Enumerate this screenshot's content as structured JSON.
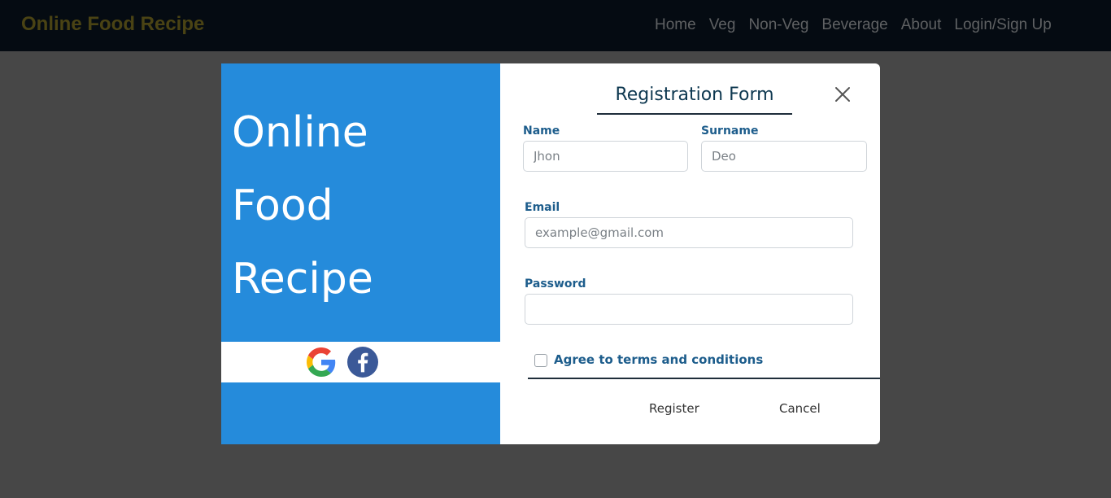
{
  "navbar": {
    "brand": "Online Food Recipe",
    "links": [
      "Home",
      "Veg",
      "Non-Veg",
      "Beverage",
      "About",
      "Login/Sign Up"
    ]
  },
  "modal": {
    "hero_lines": [
      "Online",
      "Food",
      "Recipe"
    ],
    "social_icons": [
      "google-icon",
      "facebook-icon"
    ],
    "title": "Registration Form",
    "close_icon": "close-icon",
    "fields": {
      "name": {
        "label": "Name",
        "value": "",
        "placeholder": "Jhon"
      },
      "surname": {
        "label": "Surname",
        "value": "",
        "placeholder": "Deo"
      },
      "email": {
        "label": "Email",
        "value": "",
        "placeholder": "example@gmail.com"
      },
      "password": {
        "label": "Password",
        "value": "",
        "placeholder": ""
      }
    },
    "terms_label": "Agree to terms and conditions",
    "register_label": "Register",
    "cancel_label": "Cancel"
  },
  "colors": {
    "overlay": "#474747",
    "navbar_bg": "#050b12",
    "brand": "#4a4314",
    "panel_blue": "#258bdb",
    "label_blue": "#1d5d8c",
    "title": "#0e3850"
  }
}
